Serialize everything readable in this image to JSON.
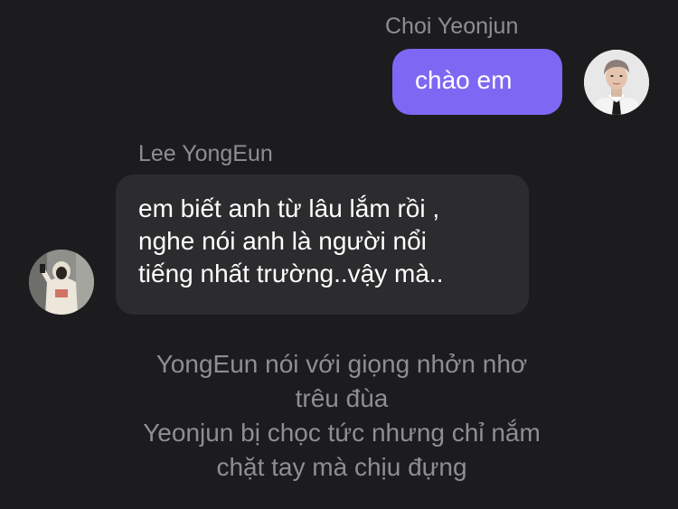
{
  "conversation": {
    "messages": [
      {
        "sender": "Choi Yeonjun",
        "side": "right",
        "text_lines": [
          "chào em"
        ]
      },
      {
        "sender": "Lee YongEun",
        "side": "left",
        "text_lines": [
          "em biết anh từ lâu lắm rồi ,",
          "nghe nói anh là người nổi",
          "tiếng nhất trường..vậy mà.."
        ]
      }
    ],
    "narration_lines": [
      "YongEun nói với giọng nhởn nhơ",
      "trêu đùa",
      "Yeonjun bị chọc tức nhưng chỉ nắm",
      "chặt tay mà chịu đựng"
    ]
  },
  "colors": {
    "background": "#1c1c1e",
    "outgoing_bubble": "#7e68f3",
    "incoming_bubble": "#2c2c2e",
    "secondary_text": "#8e8e93",
    "primary_text": "#ffffff"
  },
  "icons": {
    "right_avatar": "avatar-photo-man-white-shirt-tie",
    "left_avatar": "avatar-photo-person-white-hoodie"
  }
}
